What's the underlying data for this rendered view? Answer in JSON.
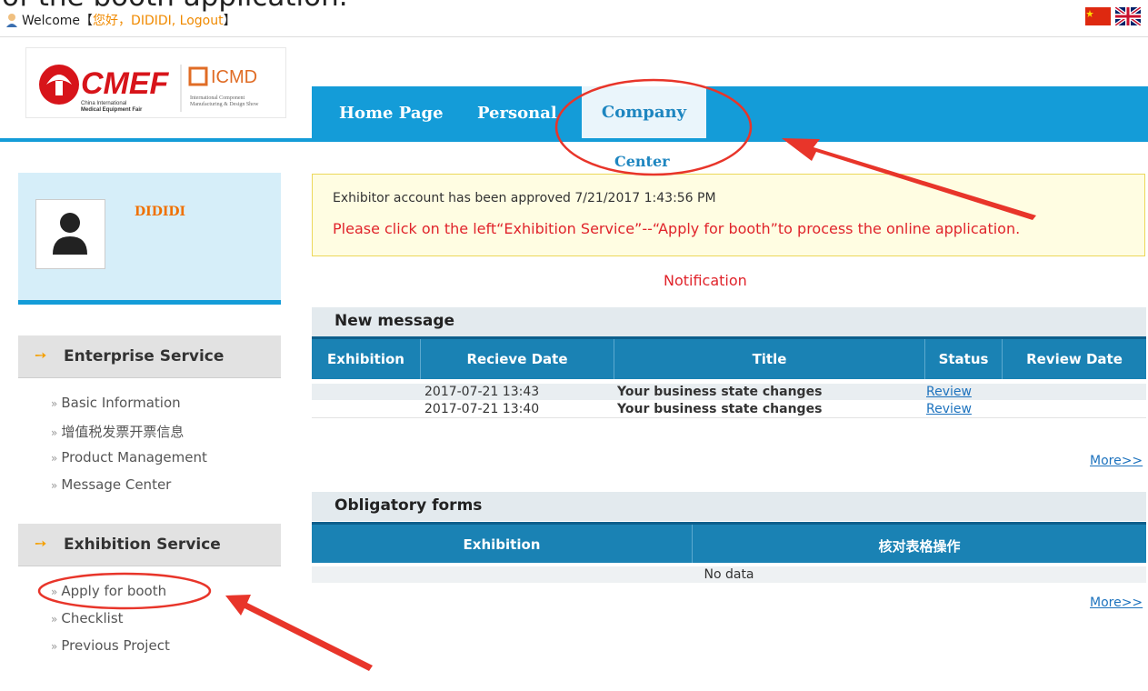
{
  "caption": "of the booth application.",
  "header": {
    "welcome_prefix": "Welcome【",
    "greeting": "您好，DIDIDI, Logout",
    "welcome_suffix": "】"
  },
  "nav": {
    "home": "Home Page",
    "personal": "Personal",
    "company": "Company",
    "center": "Center"
  },
  "profile": {
    "name": "DIDIDI"
  },
  "sidebar": {
    "enterprise": {
      "title": "Enterprise Service",
      "items": [
        "Basic Information",
        "增值税发票开票信息",
        "Product Management",
        "Message Center"
      ]
    },
    "exhibition": {
      "title": "Exhibition Service",
      "items": [
        "Apply for booth",
        "Checklist",
        "Previous Project"
      ]
    }
  },
  "notice": {
    "line1": "Exhibitor account has been approved 7/21/2017 1:43:56 PM",
    "line2": "Please click on the left“Exhibition Service”--“Apply for booth”to process the online application."
  },
  "notification_label": "Notification",
  "messages": {
    "title": "New message",
    "columns": [
      "Exhibition",
      "Recieve Date",
      "Title",
      "Status",
      "Review Date"
    ],
    "rows": [
      {
        "exhibition": "",
        "date": "2017-07-21 13:43",
        "title": "Your business state changes",
        "status": "Review",
        "review_date": ""
      },
      {
        "exhibition": "",
        "date": "2017-07-21 13:40",
        "title": "Your business state changes",
        "status": "Review",
        "review_date": ""
      }
    ],
    "more": "More>>"
  },
  "forms": {
    "title": "Obligatory forms",
    "columns": [
      "Exhibition",
      "核对表格操作"
    ],
    "empty": "No data",
    "more": "More>>"
  },
  "colors": {
    "nav_blue": "#149cd8",
    "annotation_red": "#e8352a",
    "accent_orange": "#f08a00"
  }
}
